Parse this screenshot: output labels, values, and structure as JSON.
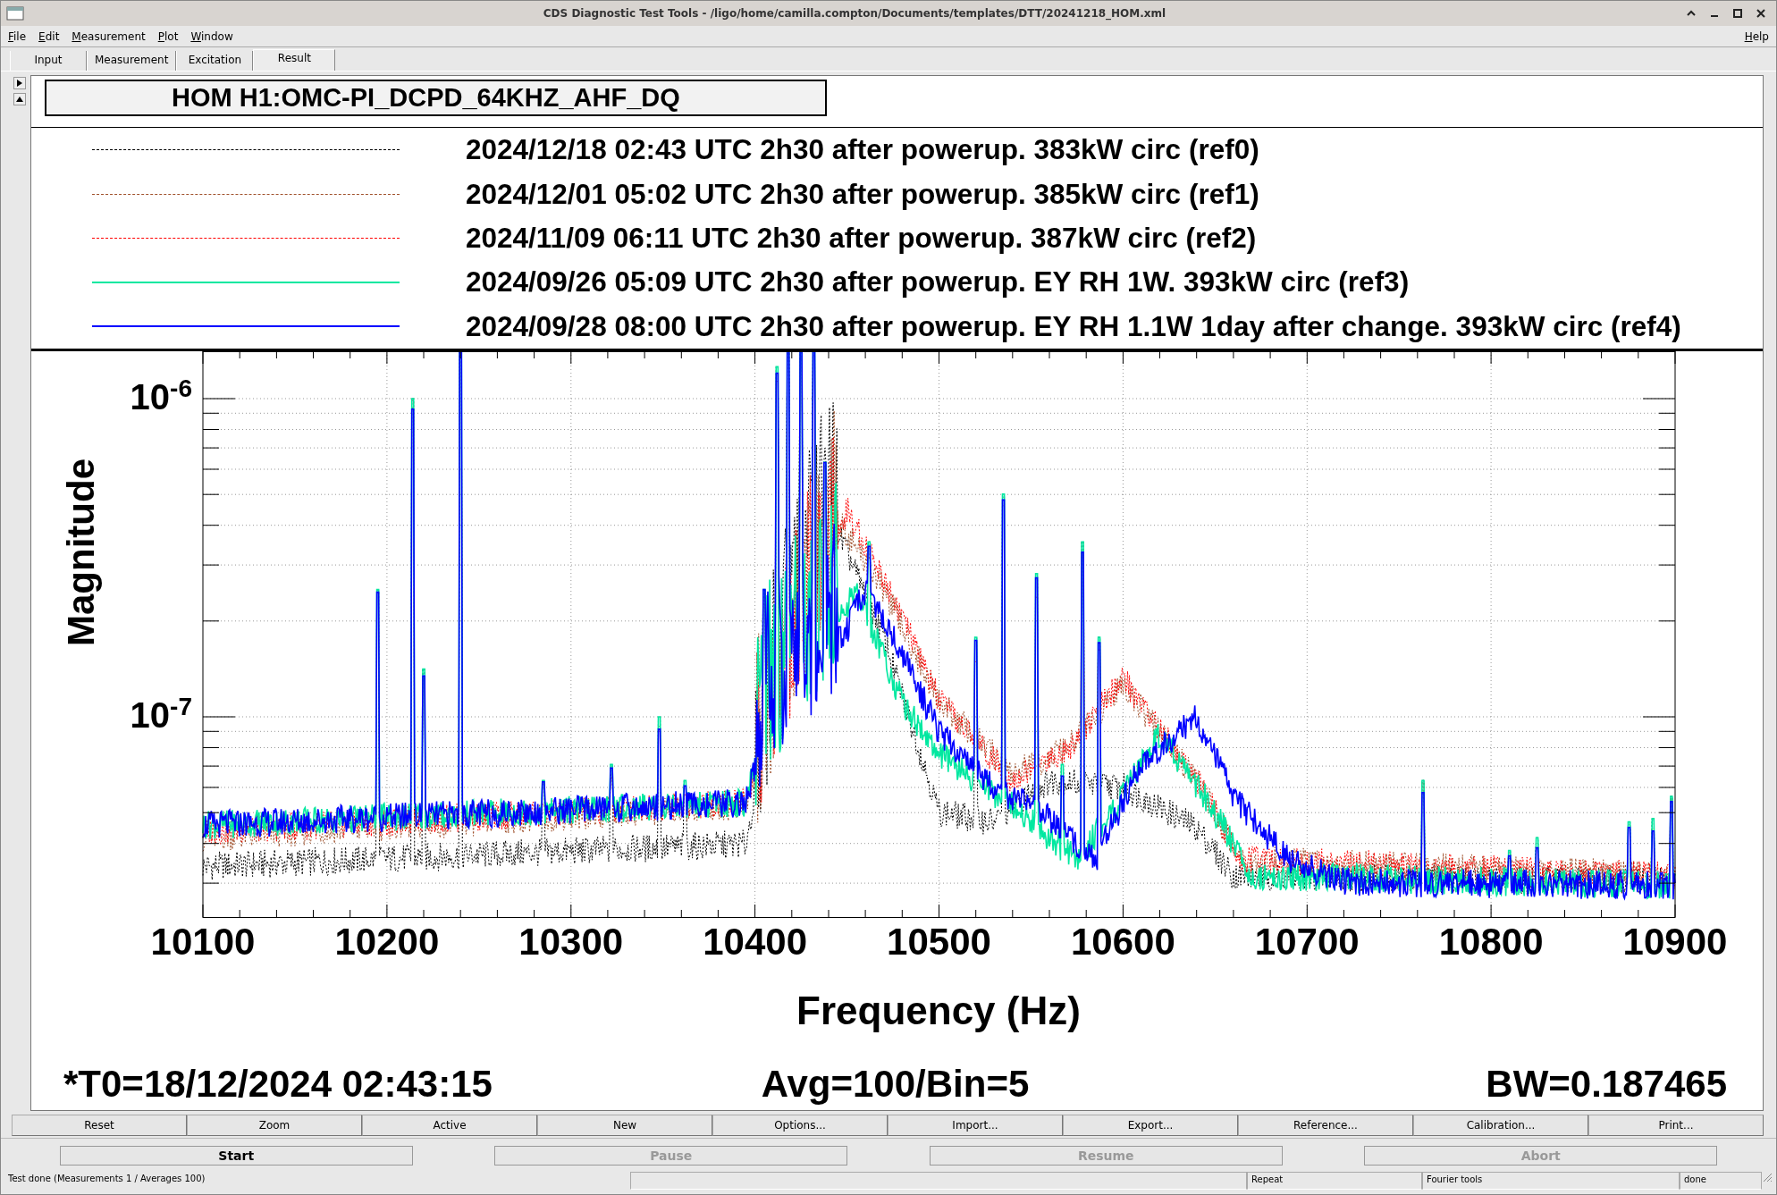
{
  "window": {
    "title": "CDS Diagnostic Test Tools - /ligo/home/camilla.compton/Documents/templates/DTT/20241218_HOM.xml"
  },
  "menu": [
    {
      "label": "File"
    },
    {
      "label": "Edit"
    },
    {
      "label": "Measurement"
    },
    {
      "label": "Plot"
    },
    {
      "label": "Window"
    }
  ],
  "help_menu": {
    "label": "Help"
  },
  "tabs": [
    {
      "label": "Input",
      "selected": false
    },
    {
      "label": "Measurement",
      "selected": false
    },
    {
      "label": "Excitation",
      "selected": false
    },
    {
      "label": "Result",
      "selected": true
    }
  ],
  "plot": {
    "title": "HOM H1:OMC-PI_DCPD_64KHZ_AHF_DQ",
    "legend": [
      {
        "label": "2024/12/18 02:43 UTC 2h30 after powerup. 383kW circ (ref0)",
        "color": "#000000",
        "kind": "dotted"
      },
      {
        "label": "2024/12/01 05:02 UTC 2h30 after powerup. 385kW circ (ref1)",
        "color": "#a0522d",
        "kind": "dotted"
      },
      {
        "label": "2024/11/09 06:11 UTC 2h30 after powerup. 387kW circ (ref2)",
        "color": "#ff0000",
        "kind": "dotted"
      },
      {
        "label": "2024/09/26 05:09 UTC 2h30 after powerup. EY RH 1W. 393kW circ (ref3)",
        "color": "#00e8a0",
        "kind": "solid"
      },
      {
        "label": "2024/09/28 08:00 UTC 2h30 after powerup. EY RH 1.1W 1day after change. 393kW circ (ref4)",
        "color": "#0000ff",
        "kind": "solid"
      }
    ],
    "ylabel": "Magnitude",
    "yticks": [
      "10$^{-6}$",
      "10$^{-7}$"
    ],
    "xlabel": "Frequency (Hz)",
    "xticks": [
      "10100",
      "10200",
      "10300",
      "10400",
      "10500",
      "10600",
      "10700",
      "10800",
      "10900"
    ],
    "footer": [
      "*T0=18/12/2024 02:43:15",
      "Avg=100/Bin=5",
      "BW=0.187465"
    ]
  },
  "plot_buttons": [
    "Reset",
    "Zoom",
    "Active",
    "New",
    "Options...",
    "Import...",
    "Export...",
    "Reference...",
    "Calibration...",
    "Print..."
  ],
  "run_buttons": [
    {
      "label": "Start",
      "disabled": false
    },
    {
      "label": "Pause",
      "disabled": true
    },
    {
      "label": "Resume",
      "disabled": true
    },
    {
      "label": "Abort",
      "disabled": true
    }
  ],
  "status_bar": [
    "Test done (Measurements 1 / Averages 100)",
    "Repeat",
    "Fourier tools",
    "done"
  ]
}
